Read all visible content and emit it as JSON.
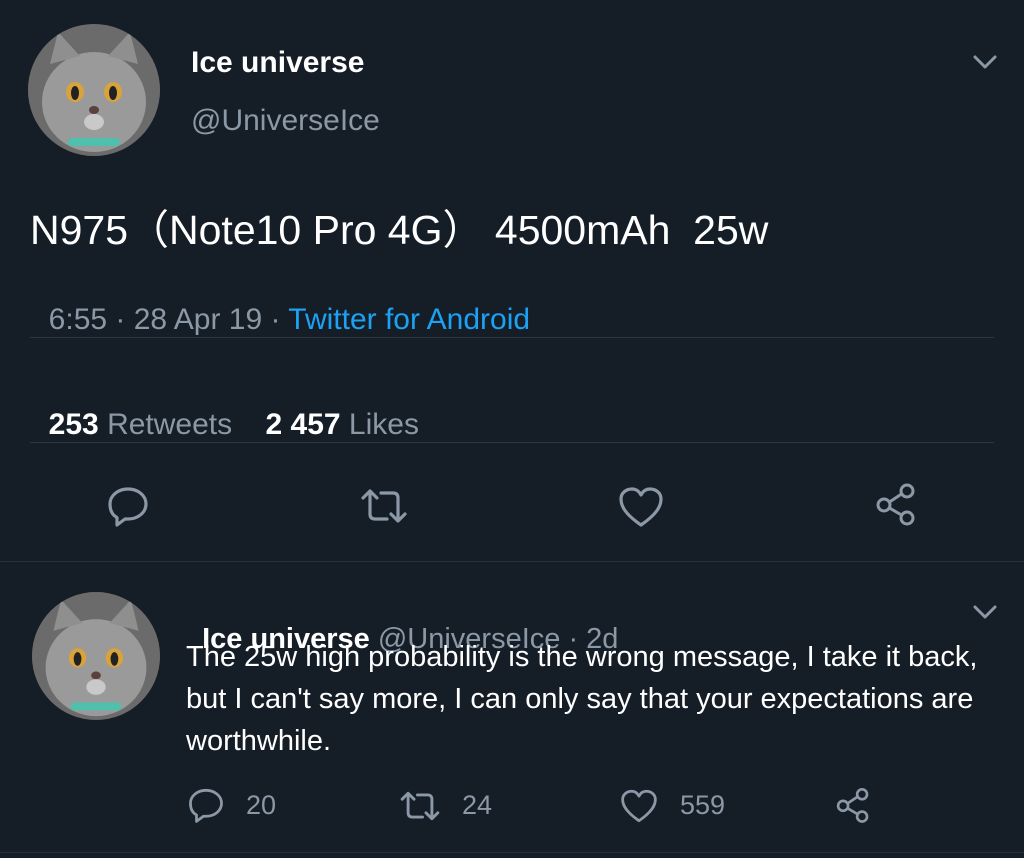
{
  "main_tweet": {
    "author_name": "Ice universe",
    "author_handle": "@UniverseIce",
    "text": "N975（Note10 Pro 4G） 4500mAh  25w",
    "time": "6:55 · 28 Apr 19 · ",
    "source": "Twitter for Android",
    "stats": {
      "retweets_count": "253",
      "retweets_label": "Retweets",
      "likes_count": "2 457",
      "likes_label": "Likes"
    },
    "icons": {
      "menu": "chevron-down-icon",
      "reply": "reply-icon",
      "retweet": "retweet-icon",
      "like": "heart-icon",
      "share": "share-icon"
    }
  },
  "reply_tweet": {
    "author_name": "Ice universe",
    "meta": "@UniverseIce · 2d",
    "text": "The 25w high probability is the wrong message, I take it back, but I can't say more, I can only say that your expectations are worthwhile.",
    "reply_count": "20",
    "retweet_count": "24",
    "like_count": "559"
  },
  "colors": {
    "background": "#151d27",
    "text": "#ffffff",
    "muted": "#8b98a5",
    "accent": "#1da1f2",
    "divider": "#2b3640"
  }
}
